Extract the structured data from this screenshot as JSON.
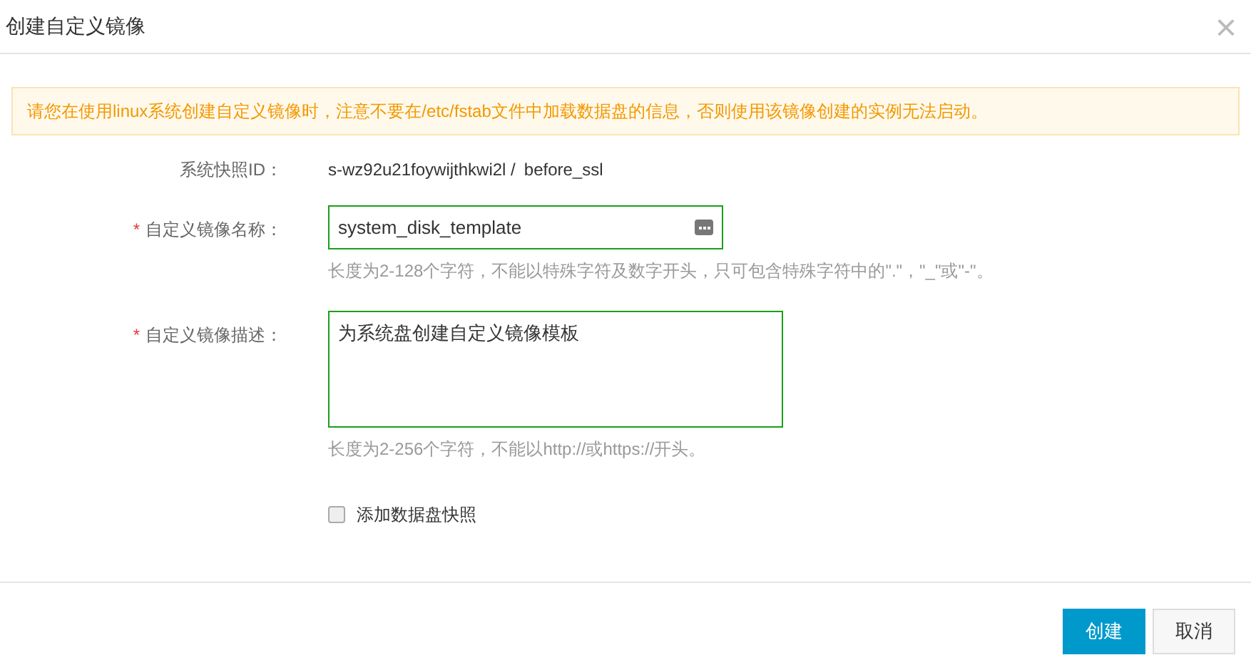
{
  "dialog": {
    "title": "创建自定义镜像",
    "close": "×"
  },
  "warning": "请您在使用linux系统创建自定义镜像时，注意不要在/etc/fstab文件中加载数据盘的信息，否则使用该镜像创建的实例无法启动。",
  "snapshot": {
    "label": "系统快照ID：",
    "id": "s-wz92u21foywijthkwi2l /",
    "name": "before_ssl"
  },
  "fields": [
    {
      "kind": "input",
      "required_mark": "*",
      "label": "自定义镜像名称：",
      "value": "system_disk_template",
      "hint": "长度为2-128个字符，不能以特殊字符及数字开头，只可包含特殊字符中的\".\"，\"_\"或\"-\"。"
    },
    {
      "kind": "textarea",
      "required_mark": "*",
      "label": "自定义镜像描述：",
      "value": "为系统盘创建自定义镜像模板",
      "hint": "长度为2-256个字符，不能以http://或https://开头。"
    }
  ],
  "add_data_disk": {
    "label": "添加数据盘快照",
    "checked": false
  },
  "buttons": [
    {
      "label": "创建",
      "kind": "primary"
    },
    {
      "label": "取消",
      "kind": "default"
    }
  ]
}
